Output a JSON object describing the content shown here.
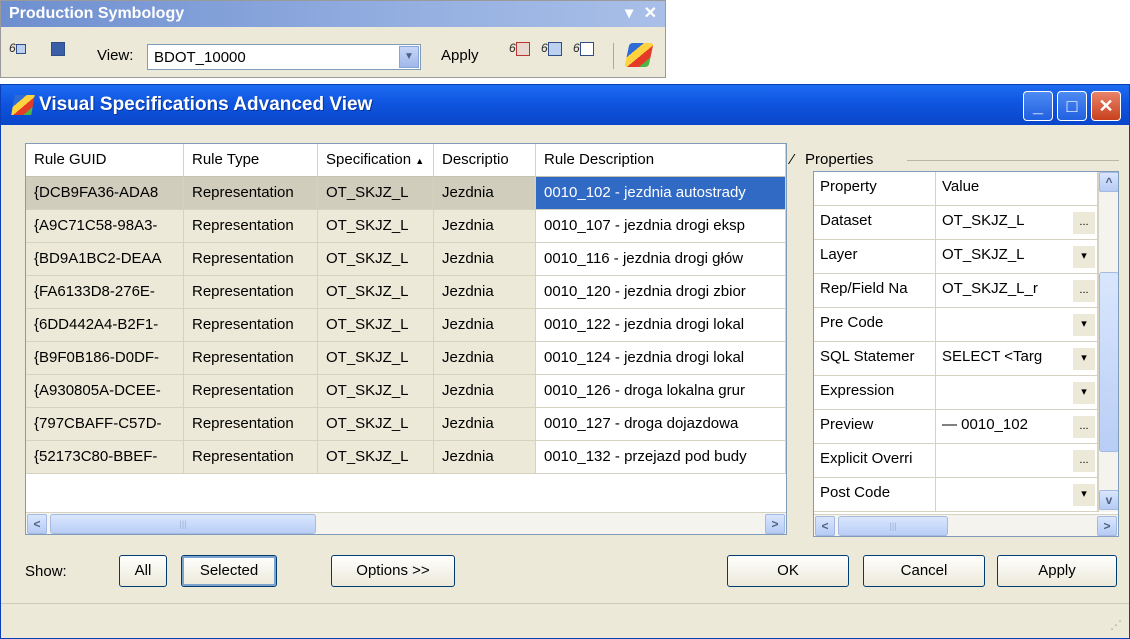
{
  "toolbar": {
    "title": "Production Symbology",
    "controls": [
      "▾",
      "✕"
    ],
    "view_label": "View:",
    "view_value": "BDOT_10000",
    "apply_label": "Apply"
  },
  "window": {
    "title": "Visual Specifications Advanced View",
    "min": "_",
    "max": "□",
    "close": "✕"
  },
  "grid": {
    "columns": [
      "Rule GUID",
      "Rule Type",
      "Specification",
      "Descriptio",
      "Rule Description"
    ],
    "sort_indicator": "▲",
    "rows": [
      [
        "{DCB9FA36-ADA8",
        "Representation",
        "OT_SKJZ_L",
        "Jezdnia",
        "0010_102 - jezdnia autostrady"
      ],
      [
        "{A9C71C58-98A3-",
        "Representation",
        "OT_SKJZ_L",
        "Jezdnia",
        "0010_107 - jezdnia drogi eksp"
      ],
      [
        "{BD9A1BC2-DEAA",
        "Representation",
        "OT_SKJZ_L",
        "Jezdnia",
        "0010_116 - jezdnia drogi głów"
      ],
      [
        "{FA6133D8-276E-",
        "Representation",
        "OT_SKJZ_L",
        "Jezdnia",
        "0010_120 - jezdnia drogi zbior"
      ],
      [
        "{6DD442A4-B2F1-",
        "Representation",
        "OT_SKJZ_L",
        "Jezdnia",
        "0010_122 - jezdnia drogi lokal"
      ],
      [
        "{B9F0B186-D0DF-",
        "Representation",
        "OT_SKJZ_L",
        "Jezdnia",
        "0010_124 - jezdnia drogi lokal"
      ],
      [
        "{A930805A-DCEE-",
        "Representation",
        "OT_SKJZ_L",
        "Jezdnia",
        "0010_126 - droga lokalna grur"
      ],
      [
        "{797CBAFF-C57D-",
        "Representation",
        "OT_SKJZ_L",
        "Jezdnia",
        "0010_127 - droga dojazdowa"
      ],
      [
        "{52173C80-BBEF-",
        "Representation",
        "OT_SKJZ_L",
        "Jezdnia",
        "0010_132 - przejazd pod budy"
      ]
    ]
  },
  "properties": {
    "label": "Properties",
    "columns": [
      "Property",
      "Value"
    ],
    "rows": [
      {
        "name": "Dataset",
        "value": "OT_SKJZ_L",
        "btn": "..."
      },
      {
        "name": "Layer",
        "value": "OT_SKJZ_L",
        "btn": "▾"
      },
      {
        "name": "Rep/Field Na",
        "value": "OT_SKJZ_L_r",
        "btn": "..."
      },
      {
        "name": "Pre Code",
        "value": "",
        "btn": "▾"
      },
      {
        "name": "SQL Statemer",
        "value": "SELECT <Targ",
        "btn": "▾"
      },
      {
        "name": "Expression",
        "value": "",
        "btn": "▾"
      },
      {
        "name": "Preview",
        "value": "—  0010_102",
        "btn": "..."
      },
      {
        "name": "Explicit Overri",
        "value": "",
        "btn": "..."
      },
      {
        "name": "Post Code",
        "value": "",
        "btn": "▾"
      }
    ]
  },
  "footer": {
    "show_label": "Show:",
    "all": "All",
    "selected": "Selected",
    "options": "Options >>",
    "ok": "OK",
    "cancel": "Cancel",
    "apply": "Apply"
  }
}
